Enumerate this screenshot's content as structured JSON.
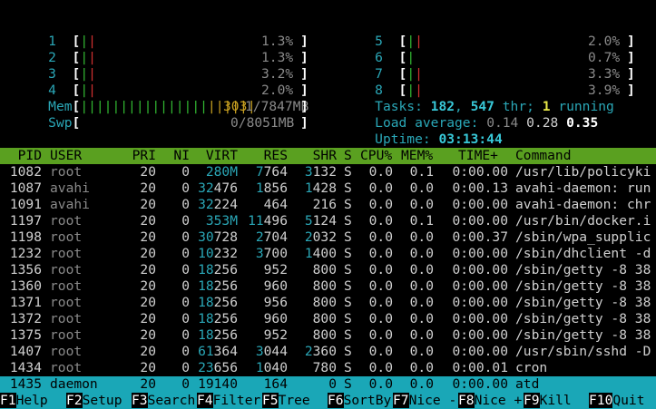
{
  "cpus": [
    {
      "id": "1",
      "percent": "1.3%"
    },
    {
      "id": "2",
      "percent": "1.3%"
    },
    {
      "id": "3",
      "percent": "3.2%"
    },
    {
      "id": "4",
      "percent": "2.0%"
    },
    {
      "id": "5",
      "percent": "2.0%"
    },
    {
      "id": "6",
      "percent": "0.7%"
    },
    {
      "id": "7",
      "percent": "3.3%"
    },
    {
      "id": "8",
      "percent": "3.9%"
    }
  ],
  "mem": {
    "label": "Mem",
    "used": "303",
    "total_text": "1/7847MB"
  },
  "swp": {
    "label": "Swp",
    "text": "0/8051MB"
  },
  "tasks": {
    "label": "Tasks:",
    "count": "182",
    "threads": "547",
    "thr_label": "thr;",
    "running": "1",
    "running_label": "running"
  },
  "load": {
    "label": "Load average:",
    "one": "0.14",
    "five": "0.28",
    "fifteen": "0.35"
  },
  "uptime": {
    "label": "Uptime:",
    "value": "03:13:44"
  },
  "columns": [
    "PID",
    "USER",
    "PRI",
    "NI",
    "VIRT",
    "RES",
    "SHR",
    "S",
    "CPU%",
    "MEM%",
    "TIME+",
    "Command"
  ],
  "processes": [
    {
      "pid": "1082",
      "user": "root",
      "pri": "20",
      "ni": "0",
      "virt_a": "",
      "virt_b": "280M",
      "res_a": "7",
      "res_b": "764",
      "shr_a": "3",
      "shr_b": "132",
      "s": "S",
      "cpu": "0.0",
      "mem": "0.1",
      "time": "0:00.00",
      "cmd": "/usr/lib/policyki"
    },
    {
      "pid": "1087",
      "user": "avahi",
      "pri": "20",
      "ni": "0",
      "virt_a": "32",
      "virt_b": "476",
      "res_a": "1",
      "res_b": "856",
      "shr_a": "1",
      "shr_b": "428",
      "s": "S",
      "cpu": "0.0",
      "mem": "0.0",
      "time": "0:00.13",
      "cmd": "avahi-daemon: run"
    },
    {
      "pid": "1091",
      "user": "avahi",
      "pri": "20",
      "ni": "0",
      "virt_a": "32",
      "virt_b": "224",
      "res_a": "",
      "res_b": "464",
      "shr_a": "",
      "shr_b": "216",
      "s": "S",
      "cpu": "0.0",
      "mem": "0.0",
      "time": "0:00.00",
      "cmd": "avahi-daemon: chr"
    },
    {
      "pid": "1197",
      "user": "root",
      "pri": "20",
      "ni": "0",
      "virt_a": "",
      "virt_b": "353M",
      "res_a": "11",
      "res_b": "496",
      "shr_a": "5",
      "shr_b": "124",
      "s": "S",
      "cpu": "0.0",
      "mem": "0.1",
      "time": "0:00.00",
      "cmd": "/usr/bin/docker.i"
    },
    {
      "pid": "1198",
      "user": "root",
      "pri": "20",
      "ni": "0",
      "virt_a": "30",
      "virt_b": "728",
      "res_a": "2",
      "res_b": "704",
      "shr_a": "2",
      "shr_b": "032",
      "s": "S",
      "cpu": "0.0",
      "mem": "0.0",
      "time": "0:00.37",
      "cmd": "/sbin/wpa_supplic"
    },
    {
      "pid": "1232",
      "user": "root",
      "pri": "20",
      "ni": "0",
      "virt_a": "10",
      "virt_b": "232",
      "res_a": "3",
      "res_b": "700",
      "shr_a": "1",
      "shr_b": "400",
      "s": "S",
      "cpu": "0.0",
      "mem": "0.0",
      "time": "0:00.00",
      "cmd": "/sbin/dhclient -d"
    },
    {
      "pid": "1356",
      "user": "root",
      "pri": "20",
      "ni": "0",
      "virt_a": "18",
      "virt_b": "256",
      "res_a": "",
      "res_b": "952",
      "shr_a": "",
      "shr_b": "800",
      "s": "S",
      "cpu": "0.0",
      "mem": "0.0",
      "time": "0:00.00",
      "cmd": "/sbin/getty -8 38"
    },
    {
      "pid": "1360",
      "user": "root",
      "pri": "20",
      "ni": "0",
      "virt_a": "18",
      "virt_b": "256",
      "res_a": "",
      "res_b": "960",
      "shr_a": "",
      "shr_b": "800",
      "s": "S",
      "cpu": "0.0",
      "mem": "0.0",
      "time": "0:00.00",
      "cmd": "/sbin/getty -8 38"
    },
    {
      "pid": "1371",
      "user": "root",
      "pri": "20",
      "ni": "0",
      "virt_a": "18",
      "virt_b": "256",
      "res_a": "",
      "res_b": "956",
      "shr_a": "",
      "shr_b": "800",
      "s": "S",
      "cpu": "0.0",
      "mem": "0.0",
      "time": "0:00.00",
      "cmd": "/sbin/getty -8 38"
    },
    {
      "pid": "1372",
      "user": "root",
      "pri": "20",
      "ni": "0",
      "virt_a": "18",
      "virt_b": "256",
      "res_a": "",
      "res_b": "960",
      "shr_a": "",
      "shr_b": "800",
      "s": "S",
      "cpu": "0.0",
      "mem": "0.0",
      "time": "0:00.00",
      "cmd": "/sbin/getty -8 38"
    },
    {
      "pid": "1375",
      "user": "root",
      "pri": "20",
      "ni": "0",
      "virt_a": "18",
      "virt_b": "256",
      "res_a": "",
      "res_b": "952",
      "shr_a": "",
      "shr_b": "800",
      "s": "S",
      "cpu": "0.0",
      "mem": "0.0",
      "time": "0:00.00",
      "cmd": "/sbin/getty -8 38"
    },
    {
      "pid": "1407",
      "user": "root",
      "pri": "20",
      "ni": "0",
      "virt_a": "61",
      "virt_b": "364",
      "res_a": "3",
      "res_b": "044",
      "shr_a": "2",
      "shr_b": "360",
      "s": "S",
      "cpu": "0.0",
      "mem": "0.0",
      "time": "0:00.00",
      "cmd": "/usr/sbin/sshd -D"
    },
    {
      "pid": "1434",
      "user": "root",
      "pri": "20",
      "ni": "0",
      "virt_a": "23",
      "virt_b": "656",
      "res_a": "1",
      "res_b": "040",
      "shr_a": "",
      "shr_b": "780",
      "s": "S",
      "cpu": "0.0",
      "mem": "0.0",
      "time": "0:00.01",
      "cmd": "cron"
    },
    {
      "pid": "1435",
      "user": "daemon",
      "pri": "20",
      "ni": "0",
      "virt_a": "",
      "virt_b": "19140",
      "res_a": "",
      "res_b": "164",
      "shr_a": "",
      "shr_b": "0",
      "s": "S",
      "cpu": "0.0",
      "mem": "0.0",
      "time": "0:00.00",
      "cmd": "atd"
    }
  ],
  "footer": [
    {
      "key": "F1",
      "label": "Help"
    },
    {
      "key": "F2",
      "label": "Setup"
    },
    {
      "key": "F3",
      "label": "Search"
    },
    {
      "key": "F4",
      "label": "Filter"
    },
    {
      "key": "F5",
      "label": "Tree"
    },
    {
      "key": "F6",
      "label": "SortBy"
    },
    {
      "key": "F7",
      "label": "Nice -"
    },
    {
      "key": "F8",
      "label": "Nice +"
    },
    {
      "key": "F9",
      "label": "Kill"
    },
    {
      "key": "F10",
      "label": "Quit"
    }
  ],
  "colors": {
    "header_bg": "#5aa020",
    "selected_bg": "#1aa7b7",
    "cyan": "#2aa7b7",
    "red": "#d03030",
    "green": "#32b832"
  }
}
